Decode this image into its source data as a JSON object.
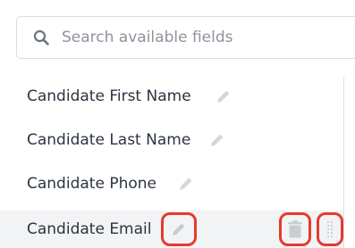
{
  "search": {
    "placeholder": "Search available fields"
  },
  "fields": [
    {
      "label": "Candidate First Name"
    },
    {
      "label": "Candidate Last Name"
    },
    {
      "label": "Candidate Phone"
    },
    {
      "label": "Candidate Email",
      "selected": true
    }
  ],
  "icons": {
    "search": "search-icon",
    "edit": "pencil-icon",
    "delete": "trash-icon",
    "reorder": "drag-handle-icon"
  },
  "colors": {
    "text": "#2b3440",
    "placeholder": "#8e949c",
    "icon_muted": "#d3d6db",
    "selected_row": "#f2f3f5",
    "highlight": "#e63a2e"
  }
}
